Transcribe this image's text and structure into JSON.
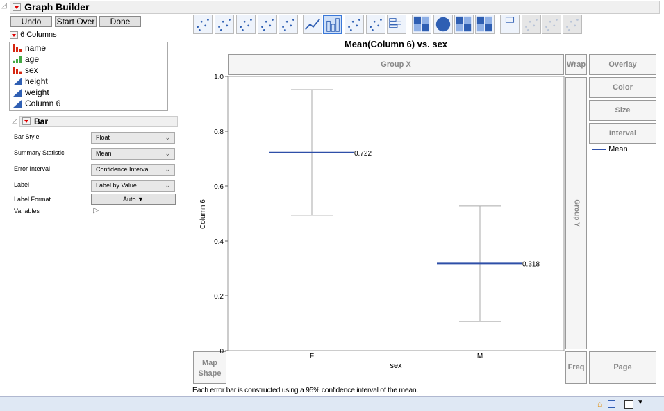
{
  "window": {
    "title": "Graph Builder"
  },
  "buttons": {
    "undo": "Undo",
    "start_over": "Start Over",
    "done": "Done"
  },
  "columns": {
    "header": "6 Columns",
    "items": [
      {
        "label": "name",
        "type": "nominal"
      },
      {
        "label": "age",
        "type": "ordinal"
      },
      {
        "label": "sex",
        "type": "nominal"
      },
      {
        "label": "height",
        "type": "continuous"
      },
      {
        "label": "weight",
        "type": "continuous"
      },
      {
        "label": "Column 6",
        "type": "continuous"
      }
    ]
  },
  "bar_panel": {
    "title": "Bar",
    "options": [
      {
        "label": "Bar Style",
        "value": "Float"
      },
      {
        "label": "Summary Statistic",
        "value": "Mean"
      },
      {
        "label": "Error Interval",
        "value": "Confidence Interval"
      },
      {
        "label": "Label",
        "value": "Label by Value"
      }
    ],
    "label_format": {
      "label": "Label Format",
      "value": "Auto"
    },
    "variables": "Variables"
  },
  "toolbar": {
    "icons": [
      "points",
      "smoother",
      "line-of-fit",
      "ellipse",
      "contour",
      "line",
      "bar",
      "area",
      "box-plot",
      "histogram",
      "heatmap",
      "pie",
      "treemap",
      "mosaic",
      "caption-box",
      "formula",
      "map-shapes",
      "parallel"
    ],
    "selected": "bar"
  },
  "zones": {
    "group_x": "Group X",
    "group_y": "Group Y",
    "wrap": "Wrap",
    "overlay": "Overlay",
    "color": "Color",
    "size": "Size",
    "interval": "Interval",
    "map_shape": "Map Shape",
    "freq": "Freq",
    "page": "Page"
  },
  "legend": {
    "mean": "Mean"
  },
  "footnote": "Each error bar is constructed using a 95% confidence interval of the mean.",
  "chart_data": {
    "type": "bar",
    "style": "float-with-error-bars",
    "title": "Mean(Column 6) vs. sex",
    "xlabel": "sex",
    "ylabel": "Column 6",
    "categories": [
      "F",
      "M"
    ],
    "values": [
      0.722,
      0.318
    ],
    "value_labels": [
      "0.722",
      "0.318"
    ],
    "ci_upper": [
      0.952,
      0.527
    ],
    "ci_lower": [
      0.494,
      0.106
    ],
    "ylim": [
      0,
      1.0
    ],
    "yticks": [
      "0",
      "0.2",
      "0.4",
      "0.6",
      "0.8",
      "1.0"
    ],
    "series_color": "#2e4fa8"
  }
}
